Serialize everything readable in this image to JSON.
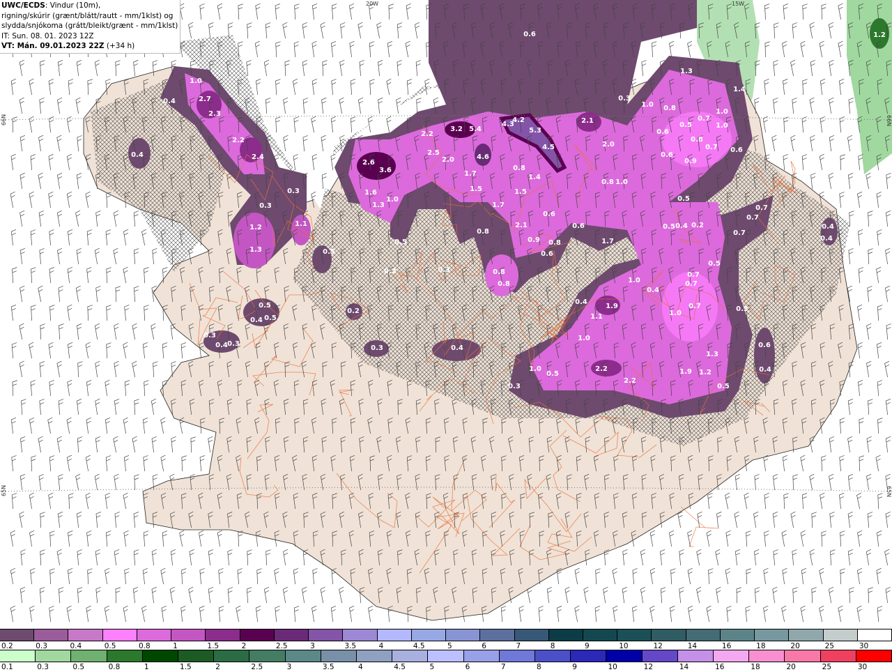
{
  "header": {
    "model": "UWC/ECDS",
    "line1_rest": ": Vindur (10m),",
    "line2": "rigning/skúrir (grænt/blátt/rautt - mm/1klst) og",
    "line3": "slydda/snjókoma (grátt/bleikt/grænt - mm/1klst)",
    "init_time": "IT: Sun. 08. 01. 2023 12Z",
    "valid_label": "VT: Mán. 09.01.2023 22Z",
    "lead": "(+34 h)"
  },
  "map": {
    "coord_labels": {
      "top_left": "20W",
      "top_right": "15W",
      "left_upper": "66N",
      "left_lower": "65N",
      "right_upper": "66N",
      "right_lower": "65N"
    },
    "colors": {
      "land": "#f0e2d6",
      "road": "#e8703a",
      "snow_outer": "#6e4a6e",
      "snow_mid": "#9a5c9a",
      "snow_inner": "#dc6adc",
      "snow_bright": "#ff80ff",
      "rain": "#a0d8a0"
    },
    "precip_labels": [
      "1.0",
      "0.4",
      "2.7",
      "2.3",
      "2.2",
      "2.4",
      "0.4",
      "0.3",
      "0.3",
      "1.2",
      "1.1",
      "1.3",
      "0.5",
      "0.5",
      "0.4",
      "0.5",
      "0.3",
      "0.4",
      "0.3",
      "0.2",
      "0.3",
      "0.4",
      "0.2",
      "0.3",
      "0.6",
      "2.6",
      "3.6",
      "1.6",
      "1.3",
      "1.0",
      "2.2",
      "3.2",
      "5.4",
      "2.5",
      "2.0",
      "4.6",
      "1.7",
      "1.5",
      "1.7",
      "0.5",
      "0.8",
      "0.8",
      "1.4",
      "1.5",
      "2.1",
      "0.6",
      "0.9",
      "0.8",
      "0.6",
      "0.8",
      "0.8",
      "4.3",
      "4.2",
      "5.3",
      "4.5",
      "0.6",
      "1.7",
      "2.1",
      "2.0",
      "0.8",
      "1.0",
      "0.3",
      "1.0",
      "0.8",
      "1.3",
      "0.6",
      "0.5",
      "0.7",
      "1.0",
      "0.8",
      "1.0",
      "0.7",
      "0.6",
      "0.6",
      "0.9",
      "1.4",
      "0.5",
      "0.5",
      "0.4",
      "0.2",
      "0.7",
      "0.7",
      "0.7",
      "0.4",
      "0.4",
      "1.2",
      "0.5",
      "0.7",
      "0.7",
      "1.0",
      "0.4",
      "0.4",
      "1.9",
      "1.1",
      "0.7",
      "1.0",
      "0.3",
      "1.0",
      "0.6",
      "0.4",
      "1.3",
      "1.0",
      "0.5",
      "0.3",
      "2.2",
      "2.2",
      "1.9",
      "1.2",
      "0.5"
    ]
  },
  "legend_snow": {
    "labels": [
      "0.2",
      "0.3",
      "0.4",
      "0.5",
      "0.8",
      "1",
      "1.5",
      "2",
      "2.5",
      "3",
      "3.5",
      "4",
      "4.5",
      "5",
      "6",
      "7",
      "8",
      "9",
      "10",
      "12",
      "14",
      "16",
      "18",
      "20",
      "25",
      "30"
    ],
    "colors": [
      "#6e4a6e",
      "#9a5c9a",
      "#c878c8",
      "#ff80ff",
      "#dc6adc",
      "#c456c4",
      "#8c2c8c",
      "#5a0050",
      "#6a2a78",
      "#8454a8",
      "#9c88d4",
      "#b4b8ff",
      "#98a8e4",
      "#8894d4",
      "#5c70a0",
      "#385878",
      "#0c3c48",
      "#144850",
      "#1c5058",
      "#305c64",
      "#446c74",
      "#5c8488",
      "#7898a0",
      "#90a8ac",
      "#c4cccc",
      "#ffffff"
    ]
  },
  "legend_rain": {
    "labels": [
      "0.1",
      "0.3",
      "0.5",
      "0.8",
      "1",
      "1.5",
      "2",
      "2.5",
      "3",
      "3.5",
      "4",
      "4.5",
      "5",
      "6",
      "7",
      "8",
      "9",
      "10",
      "12",
      "14",
      "16",
      "18",
      "20",
      "25",
      "30"
    ],
    "colors": [
      "#ccffcc",
      "#a0d8a0",
      "#70b070",
      "#2c782c",
      "#004800",
      "#1c5c24",
      "#2c6c44",
      "#447c64",
      "#5c8888",
      "#7890a8",
      "#90a0c0",
      "#a8b0e0",
      "#bcc0ff",
      "#98a0e8",
      "#7078d8",
      "#4c50c8",
      "#2c28b8",
      "#0000a8",
      "#6448c8",
      "#c490e8",
      "#f4a8f0",
      "#f890d0",
      "#f878a8",
      "#f04060",
      "#ff0000"
    ]
  }
}
